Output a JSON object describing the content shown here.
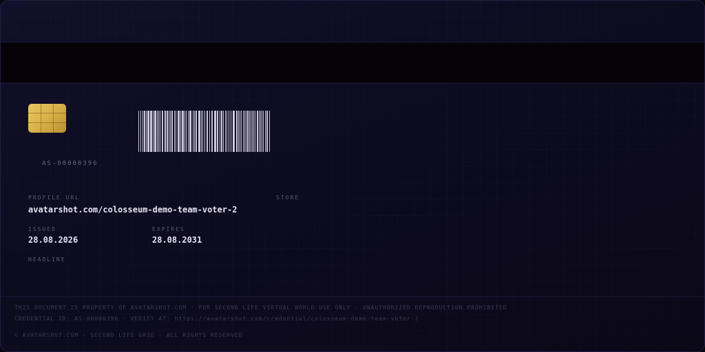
{
  "card": {
    "serial": "AS-00000396",
    "fields": {
      "profile_url_label": "PROFILE URL",
      "profile_url_value": "avatarshot.com/colosseum-demo-team-voter-2",
      "store_label": "STORE",
      "issued_label": "ISSUED",
      "issued_value": "28.08.2026",
      "expires_label": "EXPIRES",
      "expires_value": "28.08.2031",
      "headline_label": "HEADLINE"
    },
    "footer": {
      "notice": "THIS DOCUMENT IS PROPERTY OF AVATARSHOT.COM · FOR SECOND LIFE VIRTUAL WORLD USE ONLY · UNAUTHORIZED REPRODUCTION PROHIBITED",
      "credential": "CREDENTIAL ID: AS-00000396 · VERIFY AT: https://avatarshot.com/credential/colosseum-demo-team-voter-2",
      "copyright": "© AVATARSHOT.COM · SECOND LIFE GRID · ALL RIGHTS RESERVED"
    }
  },
  "colors": {
    "background": "#0d0b1f",
    "stripe": "#050308",
    "chip_gold": "#d8b048",
    "barcode": "#c9c6d8",
    "value_text": "#e6e3f2",
    "label_text": "#5f5a78"
  },
  "icons": {
    "chip": "chip-icon",
    "barcode": "barcode-icon"
  }
}
